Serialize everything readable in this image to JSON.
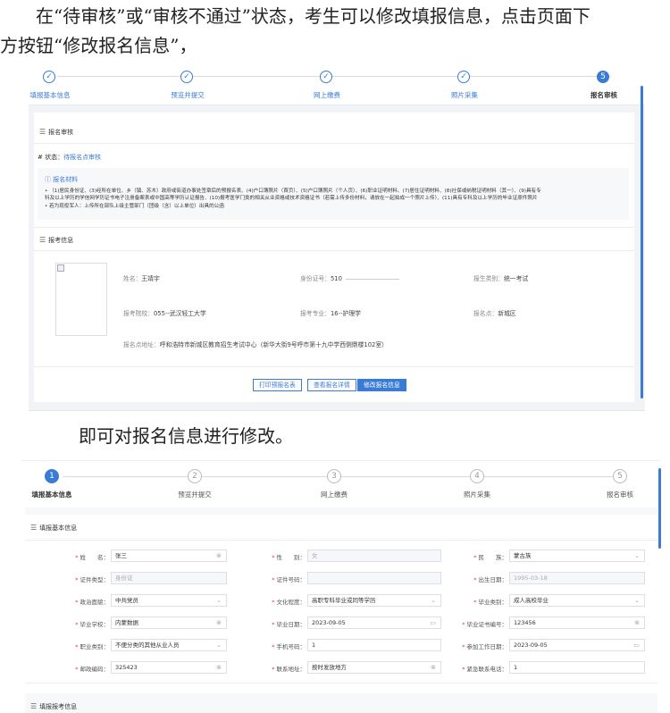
{
  "intro": {
    "line1": "在“待审核”或“审核不通过”状态，考生可以修改填报信息，点击页面下",
    "line2": "方按钮“修改报名信息”，"
  },
  "outro": "即可对报名信息进行修改。",
  "colors": {
    "accent": "#3a7bd5",
    "required": "#ee3333"
  },
  "screen1": {
    "steps": [
      {
        "label": "填报基本信息",
        "state": "done",
        "icon": "check-icon"
      },
      {
        "label": "预览并提交",
        "state": "done",
        "icon": "check-icon"
      },
      {
        "label": "网上缴费",
        "state": "done",
        "icon": "check-icon"
      },
      {
        "label": "照片采集",
        "state": "done",
        "icon": "check-icon"
      },
      {
        "label": "报名审核",
        "state": "active",
        "number": "5"
      }
    ],
    "review_section": "报名审核",
    "status_label": "# 状态：",
    "status_value": "待报名点审核",
    "materials_title": "报名材料",
    "materials_item1": "• （1)居民身份证、(3)经所在单位、乡（镇、苏木）政府或街道办事处签章后的预报名表、(4)户口簿照片（首页）、(5)户口簿照片（个人页）、(6)职业证明材料、(7)居住证明材料、(8)社保或纳税证明材料（其一）、(9)具有专",
    "materials_item1b": "科及以上学历的学信网学历证书电子注册备案表或中国高等学历认证报告、(10)报考医学门类的相关从业资格或技术资格证书（若需上传多份材料，请放在一起拍成一个照片上传）、(11)具有专科及以上学历的毕业证原件照片",
    "materials_item2": "• 若为现役军人：上传所在部队上级主管部门（团级（含）以上单位）出具的公函",
    "apply_section": "报考信息",
    "info": {
      "name_label": "姓名：",
      "name_value": "王靖宇",
      "id_label": "身份证号：",
      "id_value": "510",
      "category_label": "报生类别：",
      "category_value": "统一考试",
      "school_label": "报考院校：",
      "school_value": "055--武汉轻工大学",
      "major_label": "报考专业：",
      "major_value": "16--护理学",
      "site_label": "报名点：",
      "site_value": "新城区",
      "address_label": "报名点地址：",
      "address_value": "呼和浩特市新城区教育招生考试中心（新华大街9号呼市第十九中学西侧鼎楼102室）"
    },
    "buttons": {
      "print": "打印预报名表",
      "detail": "查看报名详情",
      "modify": "修改报名信息"
    }
  },
  "screen2": {
    "steps": [
      {
        "number": "1",
        "label": "填报基本信息",
        "state": "active"
      },
      {
        "number": "2",
        "label": "预览并提交",
        "state": "pending"
      },
      {
        "number": "3",
        "label": "网上缴费",
        "state": "pending"
      },
      {
        "number": "4",
        "label": "照片采集",
        "state": "pending"
      },
      {
        "number": "5",
        "label": "报名审核",
        "state": "pending"
      }
    ],
    "basic_section": "填报基本信息",
    "apply_section": "填报报考信息",
    "fields": {
      "name": {
        "label": "姓　　名：",
        "value": "张三"
      },
      "gender": {
        "label": "性　　别：",
        "value": "女"
      },
      "ethnic": {
        "label": "民　　族：",
        "value": "蒙古族"
      },
      "idtype": {
        "label": "证件类型：",
        "value": "身份证"
      },
      "idno": {
        "label": "证件号码：",
        "value": ""
      },
      "birth": {
        "label": "出生日期：",
        "value": "1995-03-18"
      },
      "politics": {
        "label": "政治面貌：",
        "value": "中共党员"
      },
      "education": {
        "label": "文化程度：",
        "value": "高职专科毕业或同等学历"
      },
      "gradtype": {
        "label": "毕业类别：",
        "value": "成人高校毕业"
      },
      "gradschool": {
        "label": "毕业学校：",
        "value": "内蒙数据"
      },
      "graddate": {
        "label": "毕业日期：",
        "value": "2023-09-05"
      },
      "certno": {
        "label": "毕业证书编号：",
        "value": "123456"
      },
      "job": {
        "label": "职业类别：",
        "value": "不便分类的其他从业人员"
      },
      "phone": {
        "label": "手机号码：",
        "value": "1"
      },
      "workdate": {
        "label": "参加工作日期：",
        "value": "2023-09-05"
      },
      "postcode": {
        "label": "邮政编码：",
        "value": "325423"
      },
      "contact": {
        "label": "联系地址：",
        "value": "按时发放地方"
      },
      "emergency": {
        "label": "紧急联系电话：",
        "value": "1"
      }
    }
  }
}
